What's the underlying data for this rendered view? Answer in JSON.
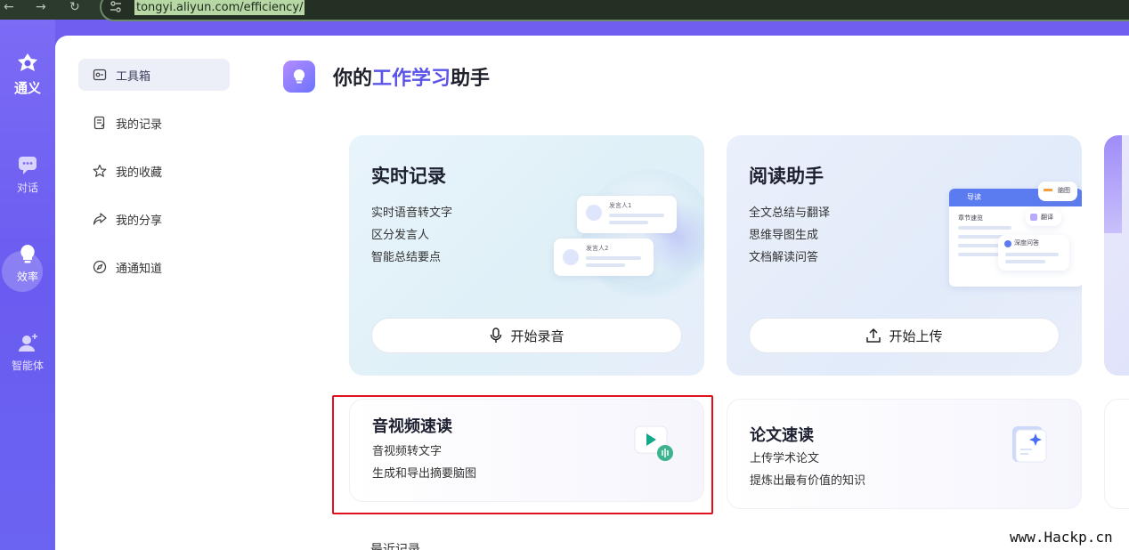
{
  "browser": {
    "url": "tongyi.aliyun.com/efficiency/",
    "back": "←",
    "forward": "→",
    "reload": "↻"
  },
  "rail": {
    "logo_text": "通义",
    "items": [
      {
        "label": "对话",
        "icon": "chat-icon"
      },
      {
        "label": "效率",
        "icon": "bulb-icon"
      },
      {
        "label": "智能体",
        "icon": "agent-icon"
      }
    ]
  },
  "menu": {
    "items": [
      {
        "label": "工具箱",
        "icon": "toolbox-icon"
      },
      {
        "label": "我的记录",
        "icon": "record-icon"
      },
      {
        "label": "我的收藏",
        "icon": "star-icon"
      },
      {
        "label": "我的分享",
        "icon": "share-icon"
      },
      {
        "label": "通通知道",
        "icon": "compass-icon"
      }
    ]
  },
  "header": {
    "prefix": "你的",
    "highlight": "工作学习",
    "suffix": "助手"
  },
  "cards": {
    "realtime": {
      "title": "实时记录",
      "lines": [
        "实时语音转文字",
        "区分发言人",
        "智能总结要点"
      ],
      "button": "开始录音",
      "speaker1": "发言人1",
      "speaker2": "发言人2"
    },
    "reading": {
      "title": "阅读助手",
      "lines": [
        "全文总结与翻译",
        "思维导图生成",
        "文档解读问答"
      ],
      "button": "开始上传",
      "guide": "导读",
      "section": "章节速览",
      "translate": "翻译",
      "qa": "深度问答",
      "mindmap": "脑图"
    },
    "av": {
      "title": "音视频速读",
      "lines": [
        "音视频转文字",
        "生成和导出摘要脑图"
      ]
    },
    "paper": {
      "title": "论文速读",
      "lines": [
        "上传学术论文",
        "提炼出最有价值的知识"
      ]
    }
  },
  "recent": "最近记录",
  "watermark": "www.Hackp.cn",
  "colors": {
    "rail": "#6a5cf0",
    "accent": "#5a54e8",
    "highlight_box": "#e0101c"
  }
}
